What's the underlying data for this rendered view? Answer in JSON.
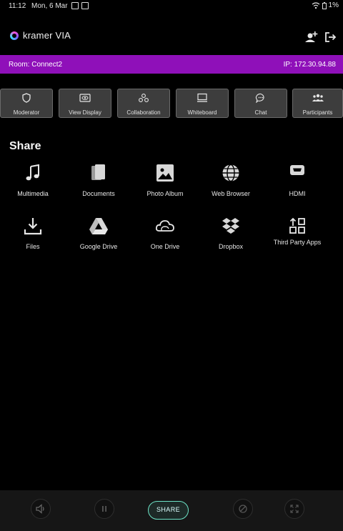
{
  "status_bar": {
    "time": "11:12",
    "date": "Mon, 6 Mar",
    "battery": "1%"
  },
  "header": {
    "logo_text": "kramer VIA",
    "add_user_icon": "add-user-icon",
    "logout_icon": "logout-icon"
  },
  "room_bar": {
    "room": "Room: Connect2",
    "ip": "IP: 172.30.94.88",
    "color": "#8f10b9"
  },
  "toolbar": {
    "items": [
      {
        "label": "Moderator",
        "icon": "shield-icon"
      },
      {
        "label": "View Display",
        "icon": "eye-icon"
      },
      {
        "label": "Collaboration",
        "icon": "collaboration-icon"
      },
      {
        "label": "Whiteboard",
        "icon": "whiteboard-icon"
      },
      {
        "label": "Chat",
        "icon": "chat-icon"
      },
      {
        "label": "Participants",
        "icon": "participants-icon"
      }
    ]
  },
  "share": {
    "heading": "Share",
    "items": [
      {
        "label": "Multimedia",
        "icon": "music-note-icon"
      },
      {
        "label": "Documents",
        "icon": "documents-icon"
      },
      {
        "label": "Photo Album",
        "icon": "photo-icon"
      },
      {
        "label": "Web Browser",
        "icon": "globe-icon"
      },
      {
        "label": "HDMI",
        "icon": "hdmi-icon"
      },
      {
        "label": "Files",
        "icon": "download-icon"
      },
      {
        "label": "Google Drive",
        "icon": "google-drive-icon"
      },
      {
        "label": "One Drive",
        "icon": "onedrive-icon"
      },
      {
        "label": "Dropbox",
        "icon": "dropbox-icon"
      },
      {
        "label": "Third Party Apps",
        "icon": "apps-icon"
      }
    ]
  },
  "bottom_bar": {
    "share_button": "SHARE",
    "accent_color": "#6de3c6"
  }
}
